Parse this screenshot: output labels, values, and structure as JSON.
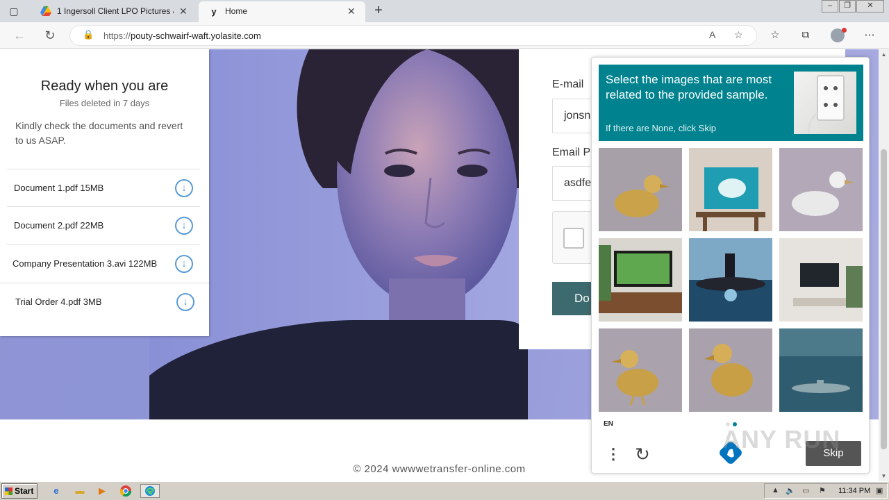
{
  "browser": {
    "tabs": [
      {
        "title": "1 Ingersoll Client LPO Pictures &",
        "favicon": "google-drive-icon",
        "active": false
      },
      {
        "title": "Home",
        "favicon": "yola-icon",
        "active": true
      }
    ],
    "url_proto": "https://",
    "url_host": "pouty-schwairf-waft.yolasite.com"
  },
  "files_card": {
    "title": "Ready when you are",
    "subtitle": "Files deleted in 7 days",
    "message": "Kindly check the documents and revert to us ASAP.",
    "files": [
      {
        "label": "Document 1.pdf 15MB"
      },
      {
        "label": "Document 2.pdf 22MB"
      },
      {
        "label": "Company Presentation 3.avi 122MB"
      },
      {
        "label": "Trial Order 4.pdf 3MB"
      }
    ]
  },
  "form": {
    "email_label": "E-mail",
    "email_value": "jonsn",
    "password_label": "Email P",
    "password_value": "asdfe",
    "button_label": "Do"
  },
  "footer": "© 2024 wwwwetransfer-online.com",
  "hcaptcha": {
    "prompt": "Select the images that are most related to the provided sample.",
    "hint": "If there are None, click Skip",
    "language": "EN",
    "skip_label": "Skip",
    "tiles": [
      "golden-duck",
      "painting-on-easel",
      "white-duck",
      "tv-on-stand",
      "submarine",
      "tv-in-living-room",
      "golden-duck",
      "golden-duck",
      "submarine-underwater"
    ]
  },
  "watermark": "ANY RUN",
  "taskbar": {
    "start_label": "Start",
    "clock": "11:34 PM"
  },
  "colors": {
    "captcha_accent": "#00838f",
    "download_button": "#3d6a6e",
    "hero_bg": "#8f96d8"
  }
}
